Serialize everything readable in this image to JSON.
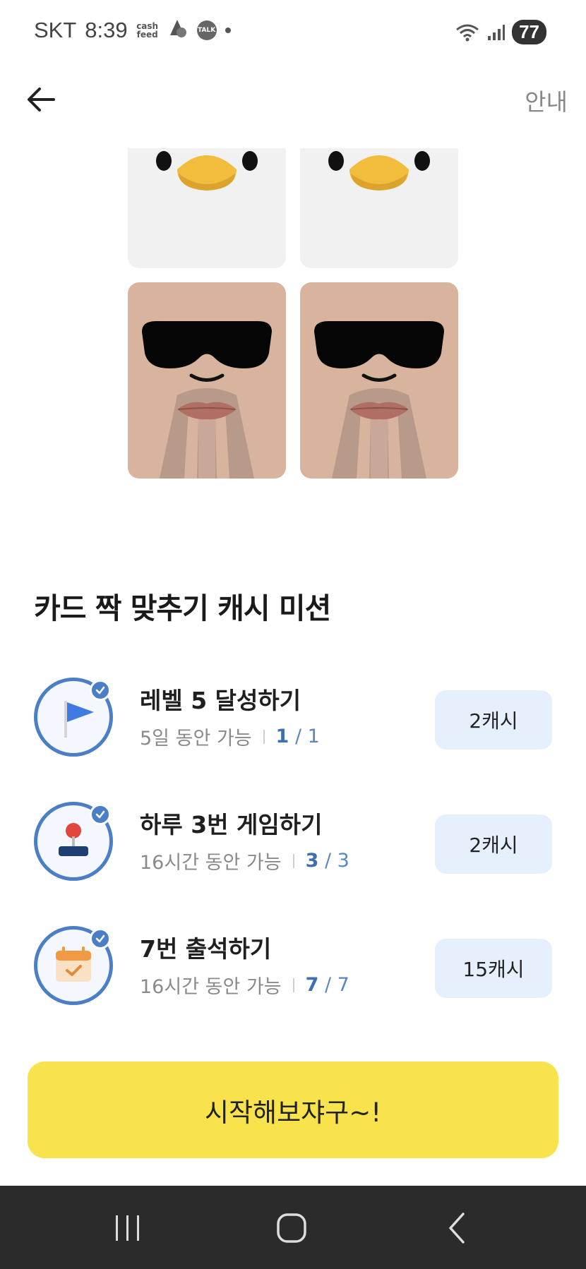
{
  "status_bar": {
    "carrier": "SKT",
    "time": "8:39",
    "app1_line1": "cash",
    "app1_line2": "feed",
    "app3": "TALK",
    "battery": "77"
  },
  "header": {
    "guide_label": "안내"
  },
  "section": {
    "title": "카드 짝 맞추기 캐시 미션"
  },
  "missions": [
    {
      "title": "레벨 5 달성하기",
      "duration": "5일 동안 가능",
      "progress_current": "1",
      "progress_total": "/ 1",
      "reward": "2캐시",
      "icon": "flag-icon",
      "completed": true
    },
    {
      "title": "하루 3번 게임하기",
      "duration": "16시간 동안 가능",
      "progress_current": "3",
      "progress_total": "/ 3",
      "reward": "2캐시",
      "icon": "joystick-icon",
      "completed": true
    },
    {
      "title": "7번 출석하기",
      "duration": "16시간 동안 가능",
      "progress_current": "7",
      "progress_total": "/ 7",
      "reward": "15캐시",
      "icon": "calendar-check-icon",
      "completed": true
    }
  ],
  "start_button": {
    "label": "시작해보쟈구~!"
  },
  "colors": {
    "accent_blue": "#4a7fc8",
    "reward_bg": "#e6f0fd",
    "start_yellow": "#f8e34c",
    "nav_bg": "#2b2b2b"
  }
}
